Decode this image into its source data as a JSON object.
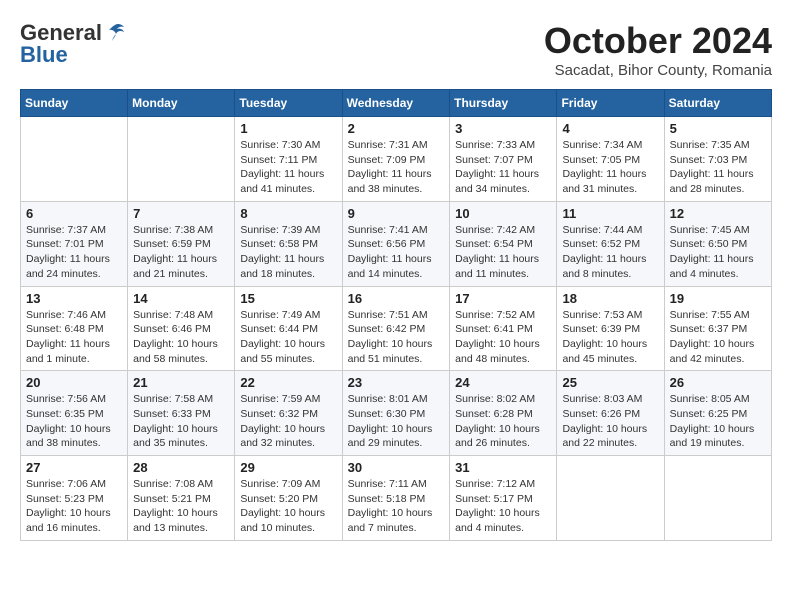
{
  "header": {
    "logo_general": "General",
    "logo_blue": "Blue",
    "month_title": "October 2024",
    "location": "Sacadat, Bihor County, Romania"
  },
  "days_of_week": [
    "Sunday",
    "Monday",
    "Tuesday",
    "Wednesday",
    "Thursday",
    "Friday",
    "Saturday"
  ],
  "weeks": [
    [
      {
        "day": "",
        "content": ""
      },
      {
        "day": "",
        "content": ""
      },
      {
        "day": "1",
        "content": "Sunrise: 7:30 AM\nSunset: 7:11 PM\nDaylight: 11 hours\nand 41 minutes."
      },
      {
        "day": "2",
        "content": "Sunrise: 7:31 AM\nSunset: 7:09 PM\nDaylight: 11 hours\nand 38 minutes."
      },
      {
        "day": "3",
        "content": "Sunrise: 7:33 AM\nSunset: 7:07 PM\nDaylight: 11 hours\nand 34 minutes."
      },
      {
        "day": "4",
        "content": "Sunrise: 7:34 AM\nSunset: 7:05 PM\nDaylight: 11 hours\nand 31 minutes."
      },
      {
        "day": "5",
        "content": "Sunrise: 7:35 AM\nSunset: 7:03 PM\nDaylight: 11 hours\nand 28 minutes."
      }
    ],
    [
      {
        "day": "6",
        "content": "Sunrise: 7:37 AM\nSunset: 7:01 PM\nDaylight: 11 hours\nand 24 minutes."
      },
      {
        "day": "7",
        "content": "Sunrise: 7:38 AM\nSunset: 6:59 PM\nDaylight: 11 hours\nand 21 minutes."
      },
      {
        "day": "8",
        "content": "Sunrise: 7:39 AM\nSunset: 6:58 PM\nDaylight: 11 hours\nand 18 minutes."
      },
      {
        "day": "9",
        "content": "Sunrise: 7:41 AM\nSunset: 6:56 PM\nDaylight: 11 hours\nand 14 minutes."
      },
      {
        "day": "10",
        "content": "Sunrise: 7:42 AM\nSunset: 6:54 PM\nDaylight: 11 hours\nand 11 minutes."
      },
      {
        "day": "11",
        "content": "Sunrise: 7:44 AM\nSunset: 6:52 PM\nDaylight: 11 hours\nand 8 minutes."
      },
      {
        "day": "12",
        "content": "Sunrise: 7:45 AM\nSunset: 6:50 PM\nDaylight: 11 hours\nand 4 minutes."
      }
    ],
    [
      {
        "day": "13",
        "content": "Sunrise: 7:46 AM\nSunset: 6:48 PM\nDaylight: 11 hours\nand 1 minute."
      },
      {
        "day": "14",
        "content": "Sunrise: 7:48 AM\nSunset: 6:46 PM\nDaylight: 10 hours\nand 58 minutes."
      },
      {
        "day": "15",
        "content": "Sunrise: 7:49 AM\nSunset: 6:44 PM\nDaylight: 10 hours\nand 55 minutes."
      },
      {
        "day": "16",
        "content": "Sunrise: 7:51 AM\nSunset: 6:42 PM\nDaylight: 10 hours\nand 51 minutes."
      },
      {
        "day": "17",
        "content": "Sunrise: 7:52 AM\nSunset: 6:41 PM\nDaylight: 10 hours\nand 48 minutes."
      },
      {
        "day": "18",
        "content": "Sunrise: 7:53 AM\nSunset: 6:39 PM\nDaylight: 10 hours\nand 45 minutes."
      },
      {
        "day": "19",
        "content": "Sunrise: 7:55 AM\nSunset: 6:37 PM\nDaylight: 10 hours\nand 42 minutes."
      }
    ],
    [
      {
        "day": "20",
        "content": "Sunrise: 7:56 AM\nSunset: 6:35 PM\nDaylight: 10 hours\nand 38 minutes."
      },
      {
        "day": "21",
        "content": "Sunrise: 7:58 AM\nSunset: 6:33 PM\nDaylight: 10 hours\nand 35 minutes."
      },
      {
        "day": "22",
        "content": "Sunrise: 7:59 AM\nSunset: 6:32 PM\nDaylight: 10 hours\nand 32 minutes."
      },
      {
        "day": "23",
        "content": "Sunrise: 8:01 AM\nSunset: 6:30 PM\nDaylight: 10 hours\nand 29 minutes."
      },
      {
        "day": "24",
        "content": "Sunrise: 8:02 AM\nSunset: 6:28 PM\nDaylight: 10 hours\nand 26 minutes."
      },
      {
        "day": "25",
        "content": "Sunrise: 8:03 AM\nSunset: 6:26 PM\nDaylight: 10 hours\nand 22 minutes."
      },
      {
        "day": "26",
        "content": "Sunrise: 8:05 AM\nSunset: 6:25 PM\nDaylight: 10 hours\nand 19 minutes."
      }
    ],
    [
      {
        "day": "27",
        "content": "Sunrise: 7:06 AM\nSunset: 5:23 PM\nDaylight: 10 hours\nand 16 minutes."
      },
      {
        "day": "28",
        "content": "Sunrise: 7:08 AM\nSunset: 5:21 PM\nDaylight: 10 hours\nand 13 minutes."
      },
      {
        "day": "29",
        "content": "Sunrise: 7:09 AM\nSunset: 5:20 PM\nDaylight: 10 hours\nand 10 minutes."
      },
      {
        "day": "30",
        "content": "Sunrise: 7:11 AM\nSunset: 5:18 PM\nDaylight: 10 hours\nand 7 minutes."
      },
      {
        "day": "31",
        "content": "Sunrise: 7:12 AM\nSunset: 5:17 PM\nDaylight: 10 hours\nand 4 minutes."
      },
      {
        "day": "",
        "content": ""
      },
      {
        "day": "",
        "content": ""
      }
    ]
  ]
}
